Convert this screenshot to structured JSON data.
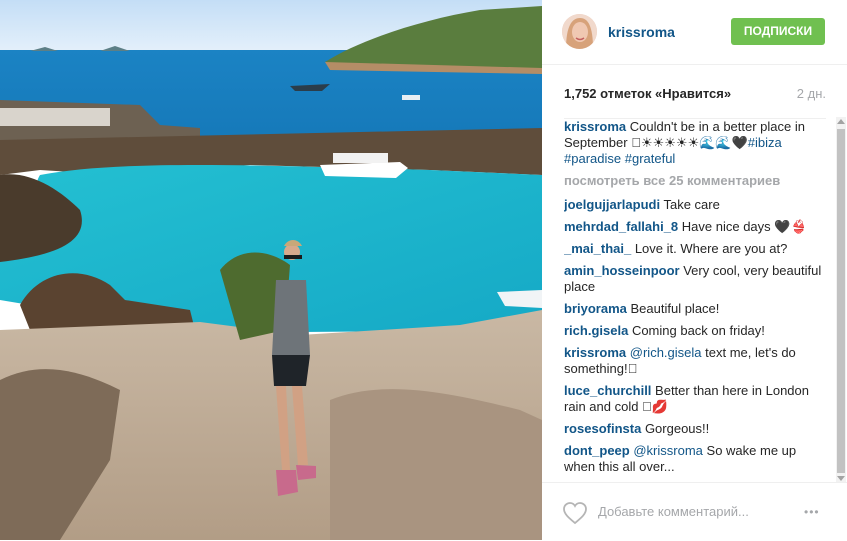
{
  "header": {
    "username": "krissroma",
    "follow_label": "ПОДПИСКИ"
  },
  "stats": {
    "likes_text": "1,752 отметок «Нравится»",
    "time_ago": "2 дн."
  },
  "caption": {
    "user": "krissroma",
    "text": "Couldn't be in a better place in September 🏼☀☀☀☀☀🌊🌊🖤",
    "tags": [
      "#ibiza",
      "#paradise",
      "#grateful"
    ]
  },
  "view_all_label": "посмотреть все 25 комментариев",
  "comments": [
    {
      "user": "joelgujjarlapudi",
      "text": "Take care"
    },
    {
      "user": "mehrdad_fallahi_8",
      "text": "Have nice days 🖤👙"
    },
    {
      "user": "_mai_thai_",
      "text": "Love it. Where are you at?"
    },
    {
      "user": "amin_hosseinpoor",
      "text": "Very cool, very beautiful place"
    },
    {
      "user": "briyorama",
      "text": "Beautiful place!"
    },
    {
      "user": "rich.gisela",
      "text": "Coming back on friday!"
    },
    {
      "user": "krissroma",
      "mention": "@rich.gisela",
      "text": "text me, let's do something!🏼"
    },
    {
      "user": "luce_churchill",
      "text": "Better than here in London rain and cold 🏼💋"
    },
    {
      "user": "rosesofinsta",
      "text": "Gorgeous!!"
    },
    {
      "user": "dont_peep",
      "mention": "@krissroma",
      "text": "So wake me up when this all over..."
    }
  ],
  "footer": {
    "add_comment_placeholder": "Добавьте комментарий...",
    "more_label": "•••"
  },
  "colors": {
    "link": "#125688",
    "follow": "#70c050",
    "muted": "#a5a7aa"
  },
  "icons": {
    "like": "heart-outline-icon",
    "more": "more-options-icon"
  }
}
